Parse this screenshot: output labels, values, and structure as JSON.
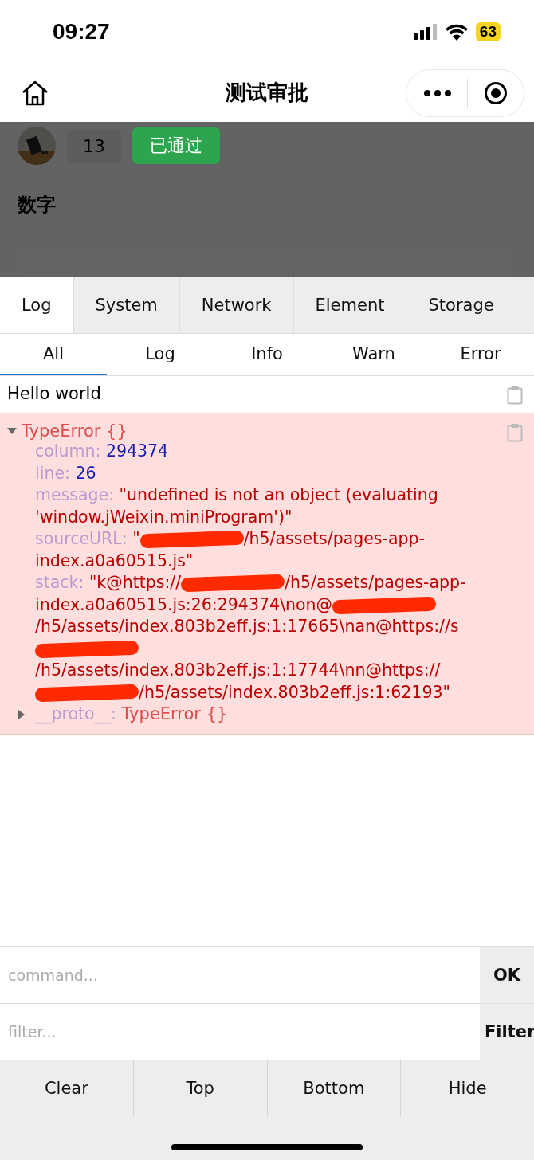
{
  "status_bar": {
    "time": "09:27",
    "battery": "63"
  },
  "nav": {
    "title": "测试审批"
  },
  "page": {
    "count": "13",
    "status": "已通过",
    "heading": "数字"
  },
  "console": {
    "tabs": [
      {
        "label": "Log",
        "selected": true
      },
      {
        "label": "System",
        "selected": false
      },
      {
        "label": "Network",
        "selected": false
      },
      {
        "label": "Element",
        "selected": false
      },
      {
        "label": "Storage",
        "selected": false
      }
    ],
    "filters": [
      {
        "label": "All",
        "selected": true
      },
      {
        "label": "Log",
        "selected": false
      },
      {
        "label": "Info",
        "selected": false
      },
      {
        "label": "Warn",
        "selected": false
      },
      {
        "label": "Error",
        "selected": false
      }
    ],
    "entries": [
      {
        "kind": "log",
        "text": "Hello world"
      },
      {
        "kind": "error",
        "title": "TypeError {}",
        "expanded": true,
        "props": [
          {
            "key": "column:",
            "kind": "number",
            "parts": [
              {
                "text": "294374"
              }
            ]
          },
          {
            "key": "line:",
            "kind": "number",
            "parts": [
              {
                "text": "26"
              }
            ]
          },
          {
            "key": "message:",
            "kind": "string",
            "parts": [
              {
                "text": "\"undefined is not an object (evaluating 'window.jWeixin.miniProgram')\""
              }
            ]
          },
          {
            "key": "sourceURL:",
            "kind": "string",
            "parts": [
              {
                "text": "\""
              },
              {
                "redacted": true
              },
              {
                "text": "/h5/assets/pages-app-index.a0a60515.js\""
              }
            ]
          },
          {
            "key": "stack:",
            "kind": "string",
            "parts": [
              {
                "text": "\"k@https://"
              },
              {
                "redacted": true
              },
              {
                "text": "/h5/assets/pages-app-index.a0a60515.js:26:294374\\non@"
              },
              {
                "redacted": true
              },
              {
                "text": "/h5/assets/index.803b2eff.js:1:17665\\nan@https://s"
              },
              {
                "redacted": true
              },
              {
                "text": "/h5/assets/index.803b2eff.js:1:17744\\nn@https://"
              },
              {
                "redacted": true
              },
              {
                "text": "/h5/assets/index.803b2eff.js:1:62193\""
              }
            ]
          }
        ],
        "proto": {
          "key": "__proto__:",
          "value": "TypeError {}",
          "expanded": false
        }
      }
    ],
    "command": {
      "placeholder": "command...",
      "button": "OK"
    },
    "filter": {
      "placeholder": "filter...",
      "button": "Filter"
    },
    "actions": [
      "Clear",
      "Top",
      "Bottom",
      "Hide"
    ]
  }
}
